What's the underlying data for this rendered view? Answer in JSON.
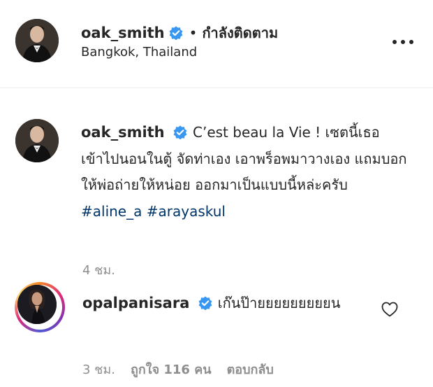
{
  "post_header": {
    "username": "oak_smith",
    "verified": true,
    "separator": "•",
    "follow_status": "กำลังติดตาม",
    "location": "Bangkok, Thailand",
    "more_icon": "more-horizontal-icon"
  },
  "caption": {
    "username": "oak_smith",
    "verified": true,
    "text_before": "C’est beau la Vie ! เซตนี้เธอเข้าไปนอนในตู้ จัดท่าเอง เอาพร็อพมาวางเอง แถมบอกให้พ่อถ่ายให้หน่อย ออกมาเป็นแบบนี้หล่ะครับ ",
    "hashtag1": "#aline_a",
    "hashtag2": "#arayaskul",
    "time": "4 ชม."
  },
  "comment": {
    "username": "opalpanisara",
    "verified": true,
    "text": "เก๊นป๊ายยยยยยยยยน",
    "time": "3 ชม.",
    "likes": "ถูกใจ 116 คน",
    "reply_label": "ตอบกลับ",
    "like_icon": "heart-outline-icon"
  },
  "colors": {
    "text": "#262626",
    "secondary": "#8e8e8e",
    "hashtag": "#003569",
    "verified": "#3897f0"
  }
}
